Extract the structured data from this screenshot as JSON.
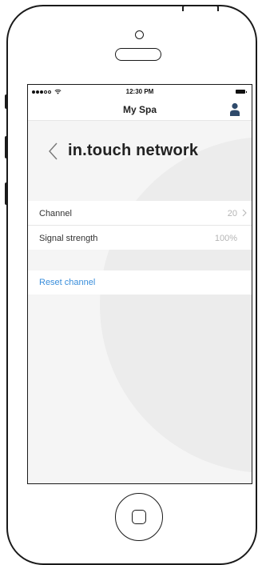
{
  "status": {
    "time": "12:30 PM"
  },
  "nav": {
    "title": "My Spa",
    "user_icon": "user-icon"
  },
  "page": {
    "title": "in.touch network",
    "back_icon": "chevron-left-icon"
  },
  "settings": [
    {
      "label": "Channel",
      "value": "20",
      "has_chevron": true
    },
    {
      "label": "Signal strength",
      "value": "100%",
      "has_chevron": false
    }
  ],
  "actions": {
    "reset_label": "Reset channel"
  },
  "colors": {
    "link": "#3a8edb",
    "user_icon": "#2e4a6b",
    "content_bg": "#f5f5f5",
    "value_text": "#b5b5b5"
  }
}
